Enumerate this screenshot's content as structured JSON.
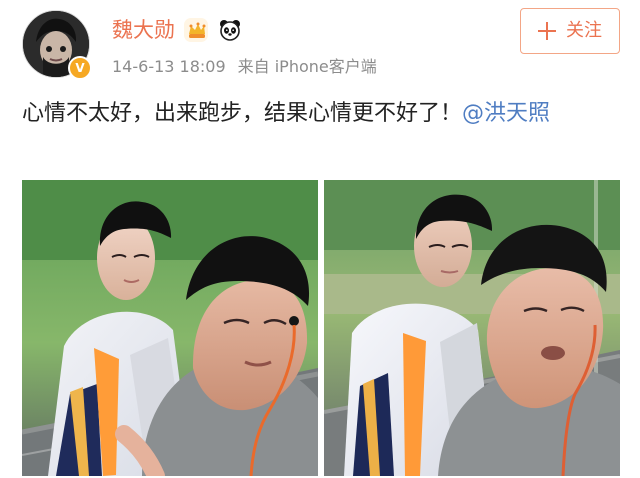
{
  "post": {
    "username": "魏大勋",
    "timestamp": "14-6-13 18:09",
    "source": "来自 iPhone客户端",
    "follow_button": "关注",
    "content_text": "心情不太好，出来跑步，结果心情更不好了！",
    "mention_text": "@洪天照",
    "verified_badge": "V",
    "images": [
      {
        "name": "post-image-1"
      },
      {
        "name": "post-image-2"
      }
    ]
  },
  "icons": {
    "avatar": "avatar",
    "verified": "verified-badge-icon",
    "crown": "crown-icon",
    "panda": "panda-icon",
    "plus": "plus-icon"
  },
  "colors": {
    "accent": "#eb7350",
    "link": "#4f7dc2",
    "meta": "#8c8c8c",
    "text": "#222222",
    "badge": "#f6a823"
  }
}
